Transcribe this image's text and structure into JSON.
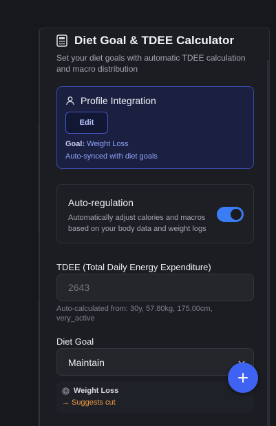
{
  "header": {
    "title": "Diet Goal & TDEE Calculator",
    "subtitle": "Set your diet goals with automatic TDEE calculation and macro distribution"
  },
  "profile": {
    "title": "Profile Integration",
    "edit_label": "Edit",
    "goal_label": "Goal:",
    "goal_value": "Weight Loss",
    "synced_text": "Auto-synced with diet goals"
  },
  "auto_regulation": {
    "title": "Auto-regulation",
    "description": "Automatically adjust calories and macros based on your body data and weight logs",
    "enabled": true
  },
  "tdee": {
    "label": "TDEE (Total Daily Energy Expenditure)",
    "placeholder": "2643",
    "hint": "Auto-calculated from: 30y, 57.80kg, 175.00cm, very_active"
  },
  "diet_goal": {
    "label": "Diet Goal",
    "selected": "Maintain"
  },
  "suggestion": {
    "title": "Weight Loss",
    "text": "→ Suggests cut"
  },
  "colors": {
    "accent": "#3b7cf4",
    "fab": "#3e63f2",
    "warning": "#f39a43",
    "profile_border": "#3b4aa8"
  },
  "icons": {
    "header": "calculator-icon",
    "profile": "user-icon",
    "select": "chevron-down-icon",
    "suggestion": "target-icon",
    "fab": "plus-icon"
  }
}
